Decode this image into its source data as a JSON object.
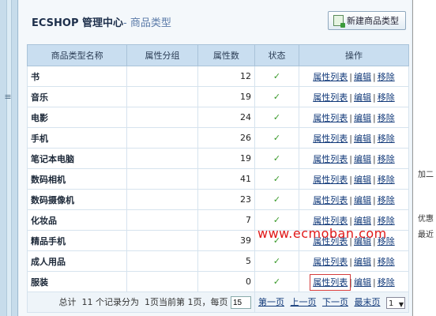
{
  "header": {
    "title": "ECSHOP 管理中心",
    "subtitle": "- 商品类型",
    "new_button_label": "新建商品类型"
  },
  "table": {
    "columns": [
      "商品类型名称",
      "属性分组",
      "属性数",
      "状态",
      "操作"
    ],
    "rows": [
      {
        "name": "书",
        "group": "",
        "count": "12"
      },
      {
        "name": "音乐",
        "group": "",
        "count": "19"
      },
      {
        "name": "电影",
        "group": "",
        "count": "24"
      },
      {
        "name": "手机",
        "group": "",
        "count": "26"
      },
      {
        "name": "笔记本电脑",
        "group": "",
        "count": "19"
      },
      {
        "name": "数码相机",
        "group": "",
        "count": "41"
      },
      {
        "name": "数码摄像机",
        "group": "",
        "count": "23"
      },
      {
        "name": "化妆品",
        "group": "",
        "count": "7"
      },
      {
        "name": "精品手机",
        "group": "",
        "count": "39"
      },
      {
        "name": "成人用品",
        "group": "",
        "count": "5"
      },
      {
        "name": "服装",
        "group": "",
        "count": "0"
      }
    ],
    "status_icon": "checkmark-icon",
    "status_glyph": "✓",
    "ops": {
      "attr_list": "属性列表",
      "edit": "编辑",
      "remove": "移除",
      "sep": "|"
    }
  },
  "pager": {
    "summary_prefix": "总计",
    "total_records": "11",
    "summary_middle": "个记录分为",
    "total_pages": "1",
    "summary_current": "页当前第",
    "current_page": "1",
    "summary_per": "页，每页",
    "per_page": "15",
    "first": "第一页",
    "prev": "上一页",
    "next": "下一页",
    "last": "最末页",
    "page_select_value": "1"
  },
  "watermark": "www.ecmoban.com",
  "right_window_fragments": [
    "加二",
    "优惠",
    "最近"
  ],
  "colors": {
    "accent": "#3a9a2a",
    "link": "#123a7a",
    "watermark": "#e01818",
    "header_bg": "#c9def0"
  }
}
